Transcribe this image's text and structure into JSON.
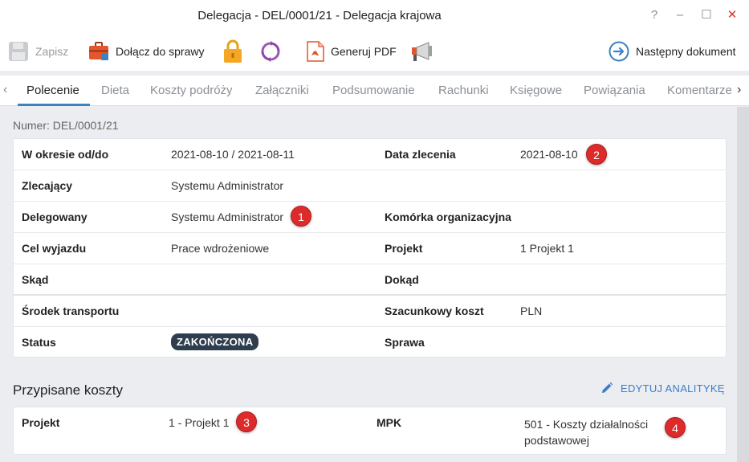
{
  "window": {
    "title": "Delegacja - DEL/0001/21 - Delegacja krajowa",
    "help": "?",
    "minimize": "–",
    "maximize": "☐",
    "close": "✕"
  },
  "toolbar": {
    "save_label": "Zapisz",
    "attach_label": "Dołącz do sprawy",
    "pdf_label": "Generuj PDF",
    "next_label": "Następny dokument"
  },
  "tabs": [
    "Polecenie",
    "Dieta",
    "Koszty podróży",
    "Załączniki",
    "Podsumowanie",
    "Rachunki",
    "Księgowe",
    "Powiązania",
    "Komentarze"
  ],
  "tab_arrows": {
    "left": "‹",
    "right": "›"
  },
  "numer": "Numer: DEL/0001/21",
  "details": {
    "okres_label": "W okresie od/do",
    "okres_value": "2021-08-10 / 2021-08-11",
    "data_zlecenia_label": "Data zlecenia",
    "data_zlecenia_value": "2021-08-10",
    "zlecajacy_label": "Zlecający",
    "zlecajacy_value": "Systemu Administrator",
    "delegowany_label": "Delegowany",
    "delegowany_value": "Systemu Administrator",
    "komorka_label": "Komórka organizacyjna",
    "cel_label": "Cel wyjazdu",
    "cel_value": "Prace wdrożeniowe",
    "projekt_label": "Projekt",
    "projekt_value": "1 Projekt 1",
    "skad_label": "Skąd",
    "dokad_label": "Dokąd",
    "srodek_label": "Środek transportu",
    "szacunkowy_label": "Szacunkowy koszt",
    "szacunkowy_value": "PLN",
    "status_label": "Status",
    "status_value": "ZAKOŃCZONA",
    "sprawa_label": "Sprawa"
  },
  "costs": {
    "title": "Przypisane koszty",
    "edit_label": "EDYTUJ ANALITYKĘ",
    "projekt_label": "Projekt",
    "projekt_value": "1 - Projekt 1",
    "mpk_label": "MPK",
    "mpk_value_line1": "501 - Koszty działalności",
    "mpk_value_line2": "podstawowej"
  },
  "markers": [
    "1",
    "2",
    "3",
    "4"
  ],
  "colors": {
    "accent": "#3b82c4",
    "marker": "#dd2b2b",
    "status_badge": "#2f3e4e"
  },
  "icons": {
    "save": "floppy-disk-icon",
    "attach": "briefcase-icon",
    "lock": "padlock-icon",
    "refresh": "circular-arrows-icon",
    "pdf": "pdf-file-icon",
    "announce": "megaphone-icon",
    "next": "arrow-right-circle-icon",
    "edit": "pencil-icon"
  }
}
